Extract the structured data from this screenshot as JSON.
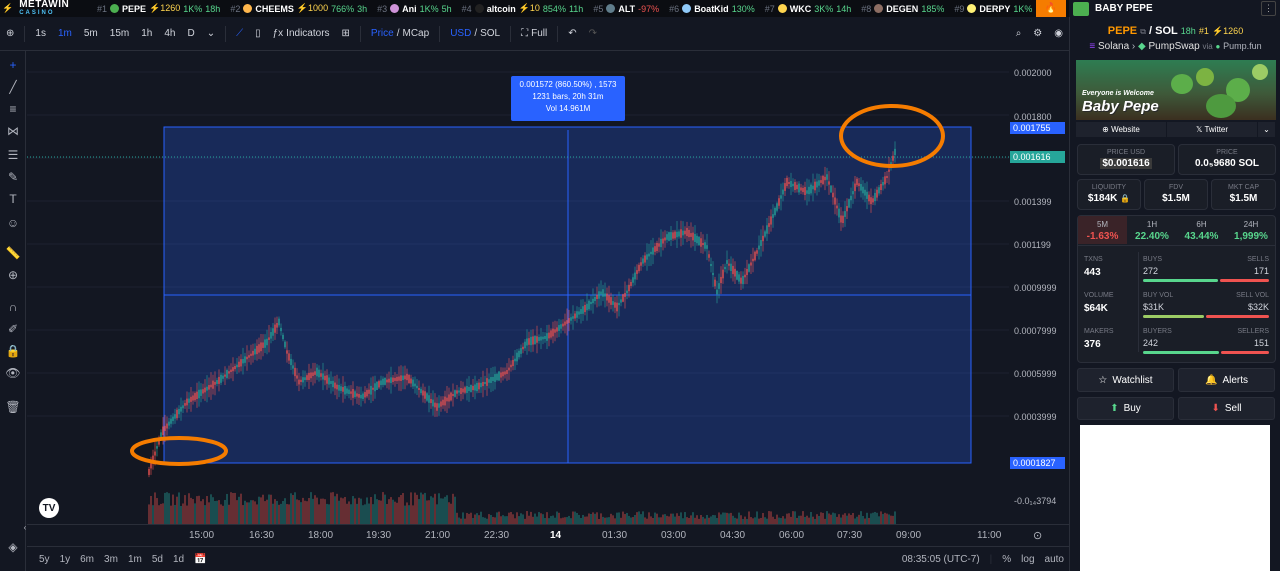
{
  "topbar": {
    "brand_name": "METAWIN",
    "brand_sub": "CASINO",
    "tickers": [
      {
        "rank": "#1",
        "name": "PEPE",
        "boosts": "⚡1260",
        "change": "1K%",
        "age": "18h",
        "change_color": "gr",
        "avatar_color": "#4caf50"
      },
      {
        "rank": "#2",
        "name": "CHEEMS",
        "boosts": "⚡1000",
        "change": "766%",
        "age": "3h",
        "change_color": "gr",
        "avatar_color": "#ffb74d"
      },
      {
        "rank": "#3",
        "name": "Ani",
        "boosts": "",
        "change": "1K%",
        "age": "5h",
        "change_color": "gr",
        "avatar_color": "#ce93d8"
      },
      {
        "rank": "#4",
        "name": "altcoin",
        "boosts": "⚡10",
        "change": "854%",
        "age": "11h",
        "change_color": "gr",
        "avatar_color": "#212121"
      },
      {
        "rank": "#5",
        "name": "ALT",
        "boosts": "",
        "change": "-97%",
        "age": "",
        "change_color": "rd",
        "avatar_color": "#607d8b"
      },
      {
        "rank": "#6",
        "name": "BoatKid",
        "boosts": "",
        "change": "130%",
        "age": "",
        "change_color": "gr",
        "avatar_color": "#90caf9"
      },
      {
        "rank": "#7",
        "name": "WKC",
        "boosts": "",
        "change": "3K%",
        "age": "14h",
        "change_color": "gr",
        "avatar_color": "#ffd54f"
      },
      {
        "rank": "#8",
        "name": "DEGEN",
        "boosts": "",
        "change": "185%",
        "age": "",
        "change_color": "gr",
        "avatar_color": "#8d6e63"
      },
      {
        "rank": "#9",
        "name": "DERPY",
        "boosts": "",
        "change": "1K%",
        "age": "",
        "change_color": "gr",
        "avatar_color": "#fff176"
      }
    ]
  },
  "pair_header": {
    "name": "BABY PEPE"
  },
  "toolbar": {
    "intervals": [
      "1s",
      "1m",
      "5m",
      "15m",
      "1h",
      "4h",
      "D"
    ],
    "active_interval": "1m",
    "indicators_label": "Indicators",
    "price_label": "Price",
    "mcap_label": "MCap",
    "usd_label": "USD",
    "sol_label": "SOL",
    "full_label": "Full"
  },
  "chart": {
    "tooltip_line1": "0.001572 (860.50%) , 1573",
    "tooltip_line2": "1231 bars, 20h 31m",
    "tooltip_line3": "Vol 14.961M",
    "price_levels": [
      "0.002000",
      "0.001800",
      "0.001399",
      "0.001199",
      "0.0009999",
      "0.0007999",
      "0.0005999",
      "0.0003999"
    ],
    "tag_top": "0.001755",
    "tag_last": "0.001616",
    "tag_bottom": "0.0001827",
    "volume_label": "-0.0₁₄3794",
    "time_labels": [
      "15:00",
      "16:30",
      "18:00",
      "19:30",
      "21:00",
      "22:30",
      "14",
      "01:30",
      "03:00",
      "04:30",
      "06:00",
      "07:30",
      "09:00",
      "11:00"
    ],
    "colors": {
      "up": "#26a69a",
      "down": "#ef5350",
      "selection": "#2962ff",
      "highlight": "#f57c00"
    }
  },
  "bottom_bar": {
    "ranges": [
      "5y",
      "1y",
      "6m",
      "3m",
      "1m",
      "5d",
      "1d"
    ],
    "clock": "08:35:05 (UTC-7)",
    "percent": "%",
    "log": "log",
    "auto": "auto"
  },
  "sidebar": {
    "base": "PEPE",
    "quote": "SOL",
    "age": "18h",
    "rank": "#1",
    "boosts": "⚡1260",
    "chain": "Solana",
    "dex": "PumpSwap",
    "via": "via",
    "launchpad": "Pump.fun",
    "banner_tagline": "Everyone is Welcome",
    "banner_name": "Baby Pepe",
    "website_label": "Website",
    "twitter_label": "Twitter",
    "price_usd_label": "PRICE USD",
    "price_usd": "$0.001616",
    "price_label": "PRICE",
    "price_sol": "0.0₅9680 SOL",
    "liquidity_label": "LIQUIDITY",
    "liquidity": "$184K",
    "fdv_label": "FDV",
    "fdv": "$1.5M",
    "mktcap_label": "MKT CAP",
    "mktcap": "$1.5M",
    "timeframes": [
      {
        "label": "5M",
        "value": "-1.63%",
        "color": "#ef5350"
      },
      {
        "label": "1H",
        "value": "22.40%",
        "color": "#58d68d"
      },
      {
        "label": "6H",
        "value": "43.44%",
        "color": "#58d68d"
      },
      {
        "label": "24H",
        "value": "1,999%",
        "color": "#58d68d"
      }
    ],
    "txns_label": "TXNS",
    "txns": "443",
    "buys_label": "BUYS",
    "buys": "272",
    "sells_label": "SELLS",
    "sells": "171",
    "volume_label": "VOLUME",
    "volume": "$64K",
    "buyvol_label": "BUY VOL",
    "buyvol": "$31K",
    "sellvol_label": "SELL VOL",
    "sellvol": "$32K",
    "makers_label": "MAKERS",
    "makers": "376",
    "buyers_label": "BUYERS",
    "buyers": "242",
    "sellers_label": "SELLERS",
    "sellers": "151",
    "watchlist_label": "Watchlist",
    "alerts_label": "Alerts",
    "buy_label": "Buy",
    "sell_label": "Sell"
  }
}
